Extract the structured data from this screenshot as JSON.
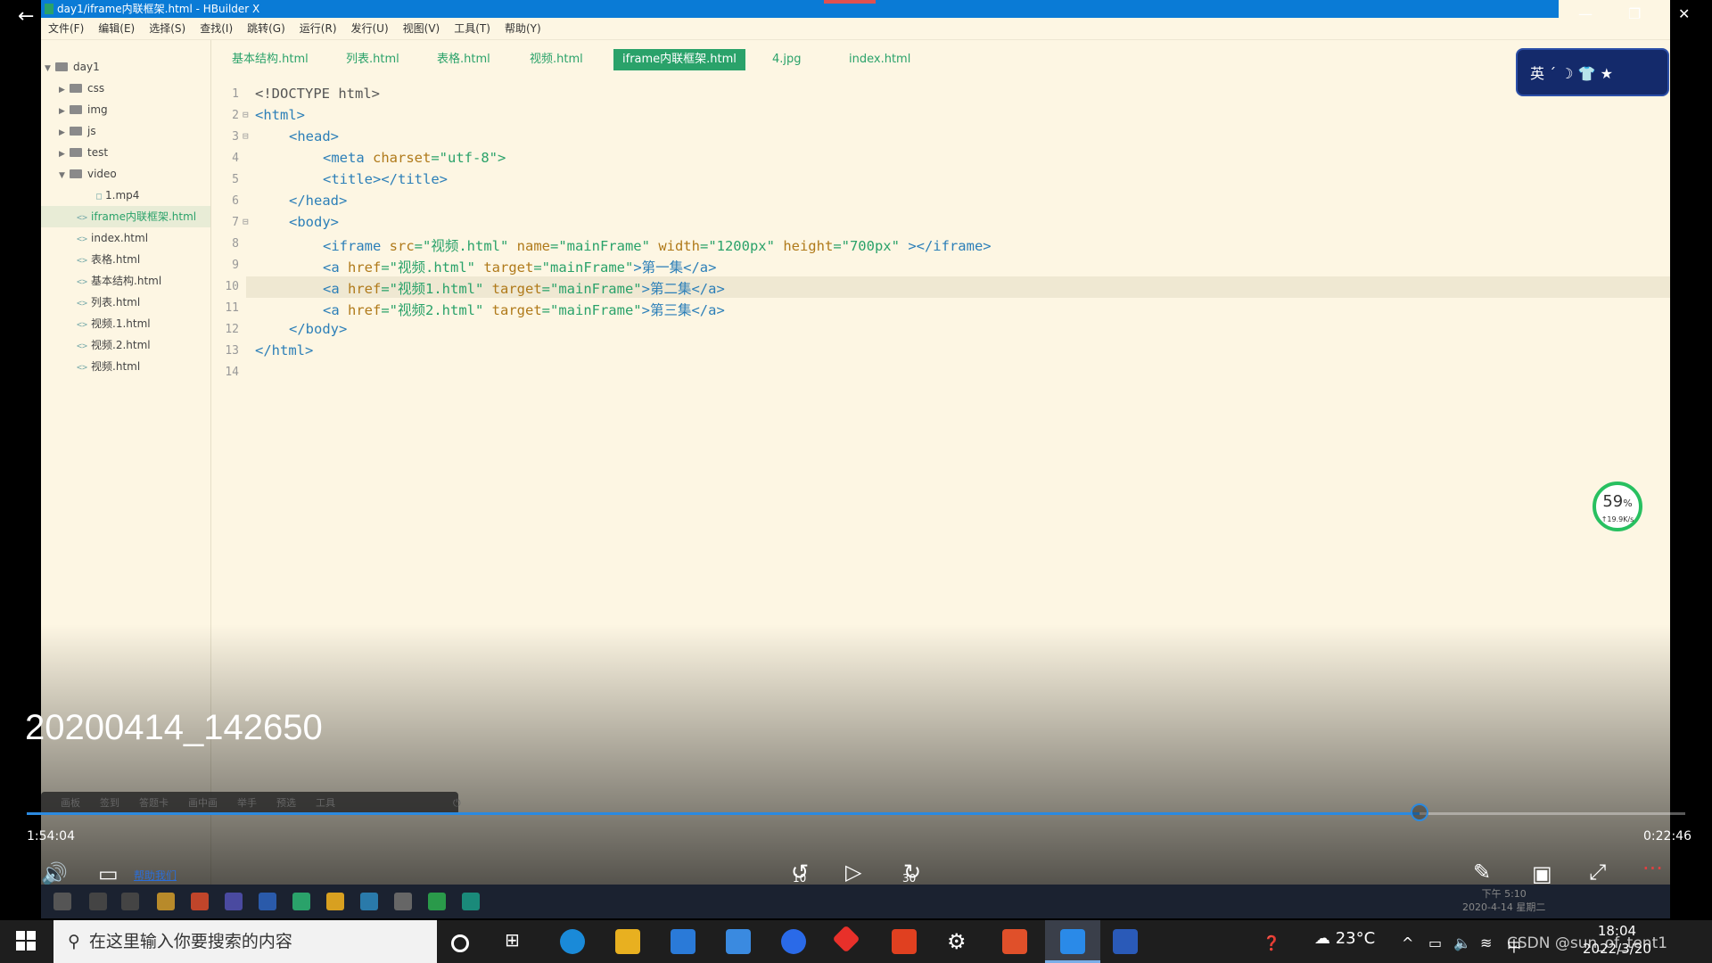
{
  "window": {
    "title": "day1/iframe内联框架.html - HBuilder X"
  },
  "menu": [
    "文件(F)",
    "编辑(E)",
    "选择(S)",
    "查找(I)",
    "跳转(G)",
    "运行(R)",
    "发行(U)",
    "视图(V)",
    "工具(T)",
    "帮助(Y)"
  ],
  "sidebar": {
    "project": "day1",
    "folders": [
      "css",
      "img",
      "js",
      "test",
      "video"
    ],
    "video_children": [
      "1.mp4"
    ],
    "files": [
      "iframe内联框架.html",
      "index.html",
      "表格.html",
      "基本结构.html",
      "列表.html",
      "视频.1.html",
      "视频.2.html",
      "视频.html"
    ]
  },
  "tabs": [
    "基本结构.html",
    "列表.html",
    "表格.html",
    "视频.html",
    "iframe内联框架.html",
    "4.jpg",
    "index.html"
  ],
  "editor": {
    "line_numbers": [
      "1",
      "2",
      "3",
      "4",
      "5",
      "6",
      "7",
      "8",
      "9",
      "10",
      "11",
      "12",
      "13",
      "14"
    ],
    "lines": {
      "l1": "<!DOCTYPE html>",
      "l2": "<html>",
      "l3": "<head>",
      "l4a": "<meta ",
      "l4b": "charset",
      "l4c": "=\"utf-8\">",
      "l5": "<title></title>",
      "l6": "</head>",
      "l7": "<body>",
      "l8a": "<iframe ",
      "l8b": "src",
      "l8c": "=\"视频.html\" ",
      "l8d": "name",
      "l8e": "=\"mainFrame\" ",
      "l8f": "width",
      "l8g": "=\"1200px\" ",
      "l8h": "height",
      "l8i": "=\"700px\" ",
      "l8j": "></iframe>",
      "l9a": "<a ",
      "l9b": "href",
      "l9c": "=\"视频.html\" ",
      "l9d": "target",
      "l9e": "=\"mainFrame\"",
      "l9f": ">第一集</a>",
      "l10a": "<a ",
      "l10b": "href",
      "l10c": "=\"视频1.html\" ",
      "l10d": "target",
      "l10e": "=\"mainFrame\"",
      "l10f": ">第二集</a>",
      "l11a": "<a ",
      "l11b": "href",
      "l11c": "=\"视频2.html\" ",
      "l11d": "target",
      "l11e": "=\"mainFrame\"",
      "l11f": ">第三集</a>",
      "l12": "</body>",
      "l13": "</html>"
    }
  },
  "widget": {
    "text": "英 ˊ ☽ 👕 ★"
  },
  "speed": {
    "percent": "59",
    "unit": "%",
    "rate": "↑19.9K/s"
  },
  "player": {
    "video_title": "20200414_142650",
    "elapsed": "1:54:04",
    "remaining": "0:22:46",
    "progress": 0.84,
    "skip_back": "10",
    "skip_forward": "30",
    "toolstrip": [
      "画板",
      "签到",
      "答题卡",
      "画中画",
      "举手",
      "预选",
      "工具"
    ],
    "help_link": "帮助我们"
  },
  "inner_clock": {
    "time": "下午 5:10",
    "date": "2020-4-14 星期二"
  },
  "taskbar": {
    "search_placeholder": "在这里输入你要搜索的内容",
    "weather": "23°C",
    "ime": "中",
    "time": "18:04",
    "date": "2022/3/20",
    "watermark": "CSDN @sun_of_tent1"
  },
  "colors": {
    "accent": "#2aa26a",
    "titlebar": "#0a7bd6",
    "progress": "#2b8ae0"
  }
}
